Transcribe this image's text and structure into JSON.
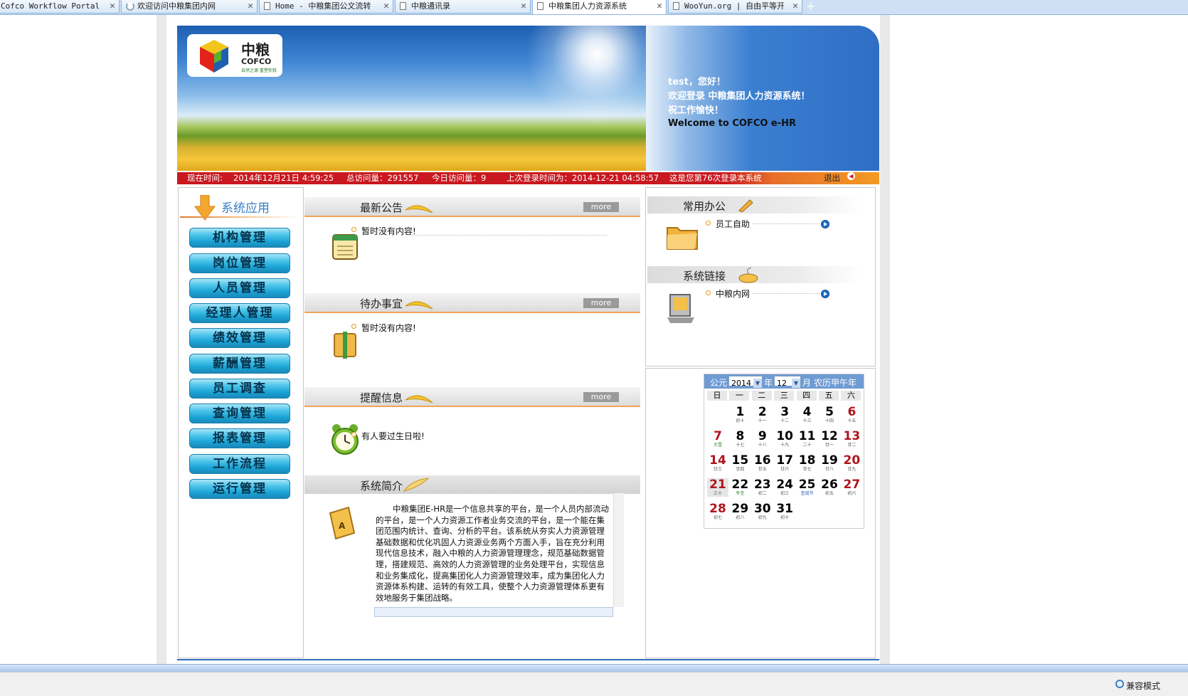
{
  "browser": {
    "tabs": [
      {
        "title": "Cofco Workflow Portal",
        "icon": "page-icon",
        "close": "✕"
      },
      {
        "title": "欢迎访问中粮集团内网",
        "icon": "loading-icon",
        "close": "✕"
      },
      {
        "title": "Home - 中粮集团公文流转",
        "icon": "page-icon",
        "close": "✕"
      },
      {
        "title": "中粮通讯录",
        "icon": "page-icon",
        "close": "✕"
      },
      {
        "title": "中粮集团人力资源系统",
        "icon": "page-icon",
        "close": "✕",
        "active": true
      },
      {
        "title": "WooYun.org | 自由平等开放",
        "icon": "page-icon",
        "close": "✕"
      }
    ],
    "new_tab": "+",
    "status_right": "兼容模式"
  },
  "header": {
    "logo_cn": "中粮",
    "logo_en": "COFCO",
    "logo_slogan": "自然之源 重塑你我",
    "welcome_lines": [
      "test，您好！",
      "欢迎登录 中粮集团人力资源系统！",
      "祝工作愉快！"
    ],
    "welcome_en": "Welcome to COFCO e-HR"
  },
  "status": {
    "time_label": "现在时间:",
    "time_value": "2014年12月21日  4:59:25",
    "total_visits": "总访问量：291557",
    "today_visits": "今日访问量：9",
    "last_login": "上次登录时间为：2014-12-21 04:58:57",
    "login_count": "这是您第76次登录本系统",
    "logout": "退出"
  },
  "menu": {
    "title": "系统应用",
    "items": [
      "机构管理",
      "岗位管理",
      "人员管理",
      "经理人管理",
      "绩效管理",
      "薪酬管理",
      "员工调查",
      "查询管理",
      "报表管理",
      "工作流程",
      "运行管理"
    ]
  },
  "sections": {
    "notice": {
      "title": "最新公告",
      "more": "more",
      "item": "暂时没有内容!"
    },
    "todo": {
      "title": "待办事宜",
      "more": "more",
      "item": "暂时没有内容!"
    },
    "reminder": {
      "title": "提醒信息",
      "more": "more",
      "item": "有人要过生日啦!"
    },
    "intro": {
      "title": "系统简介",
      "text": "中粮集团E-HR是一个信息共享的平台，是一个人员内部流动的平台，是一个人力资源工作者业务交流的平台，是一个能在集团范围内统计、查询、分析的平台。该系统从夯实人力资源管理基础数据和优化巩固人力资源业务两个方面入手，旨在充分利用现代信息技术，融入中粮的人力资源管理理念，规范基础数据管理，搭建规范、高效的人力资源管理的业务处理平台，实现信息和业务集成化，提高集团化人力资源管理效率，成为集团化人力资源体系构建、运转的有效工具，使整个人力资源管理体系更有效地服务于集团战略。"
    }
  },
  "office": {
    "title": "常用办公",
    "item": "员工自助"
  },
  "links": {
    "title": "系统链接",
    "item": "中粮内网"
  },
  "calendar": {
    "era_label": "公元",
    "year": "2014",
    "year_label": "年",
    "month": "12",
    "month_label": "月",
    "lunar_year": "农历甲午年",
    "weekdays": [
      "日",
      "一",
      "二",
      "三",
      "四",
      "五",
      "六"
    ],
    "first_weekday": 1,
    "today": 21,
    "days": [
      {
        "d": "1",
        "l": "初十"
      },
      {
        "d": "2",
        "l": "十一"
      },
      {
        "d": "3",
        "l": "十二"
      },
      {
        "d": "4",
        "l": "十三"
      },
      {
        "d": "5",
        "l": "十四"
      },
      {
        "d": "6",
        "l": "十五"
      },
      {
        "d": "7",
        "l": "大雪"
      },
      {
        "d": "8",
        "l": "十七"
      },
      {
        "d": "9",
        "l": "十八"
      },
      {
        "d": "10",
        "l": "十九"
      },
      {
        "d": "11",
        "l": "二十"
      },
      {
        "d": "12",
        "l": "廿一"
      },
      {
        "d": "13",
        "l": "廿二"
      },
      {
        "d": "14",
        "l": "廿三"
      },
      {
        "d": "15",
        "l": "廿四"
      },
      {
        "d": "16",
        "l": "廿五"
      },
      {
        "d": "17",
        "l": "廿六"
      },
      {
        "d": "18",
        "l": "廿七"
      },
      {
        "d": "19",
        "l": "廿八"
      },
      {
        "d": "20",
        "l": "廿九"
      },
      {
        "d": "21",
        "l": "三十"
      },
      {
        "d": "22",
        "l": "冬至"
      },
      {
        "d": "23",
        "l": "初二"
      },
      {
        "d": "24",
        "l": "初三"
      },
      {
        "d": "25",
        "l": "圣诞节"
      },
      {
        "d": "26",
        "l": "初五"
      },
      {
        "d": "27",
        "l": "初六"
      },
      {
        "d": "28",
        "l": "初七"
      },
      {
        "d": "29",
        "l": "初八"
      },
      {
        "d": "30",
        "l": "初九"
      },
      {
        "d": "31",
        "l": "初十"
      }
    ]
  },
  "colors": {
    "accent_red": "#c9181f",
    "menu_cyan": "#1aa3d4",
    "header_blue": "#2f6ec4",
    "holiday_red": "#b1141c"
  }
}
